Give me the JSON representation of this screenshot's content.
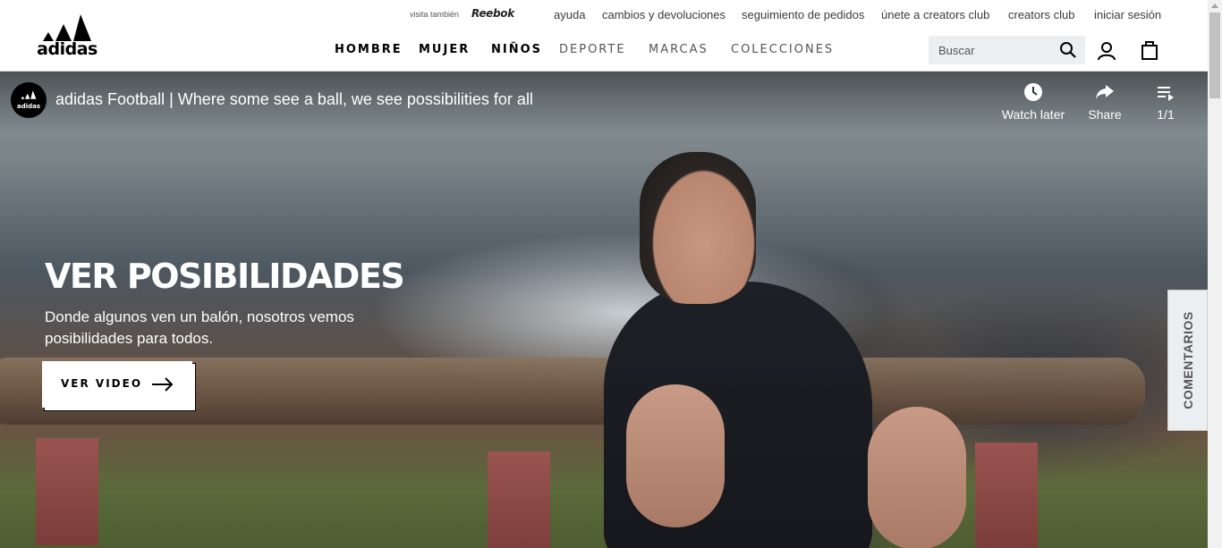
{
  "header": {
    "logo_text": "adidas",
    "visit_also": "visita también",
    "reebok": "Reebok",
    "util_links": [
      "ayuda",
      "cambios y devoluciones",
      "seguimiento de pedidos",
      "únete a creators club",
      "creators club",
      "iniciar sesión"
    ],
    "nav": [
      "HOMBRE",
      "MUJER",
      "NIÑOS",
      "DEPORTE",
      "MARCAS",
      "COLECCIONES"
    ],
    "search_placeholder": "Buscar"
  },
  "video": {
    "channel_mini": "adidas",
    "title": "adidas Football | Where some see a ball, we see possibilities for all",
    "watch_later": "Watch later",
    "share": "Share",
    "playlist_count": "1/1"
  },
  "hero": {
    "heading": "VER POSIBILIDADES",
    "subheading": "Donde algunos ven un balón, nosotros vemos posibilidades para todos.",
    "cta": "VER VIDEO"
  },
  "feedback_tab": "COMENTARIOS",
  "colors": {
    "accent": "#000000",
    "search_bg": "#eceff1"
  }
}
